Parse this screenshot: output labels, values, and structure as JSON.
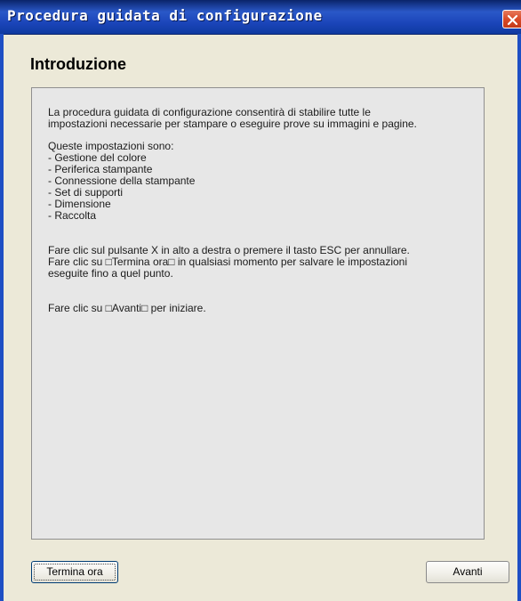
{
  "window": {
    "title": "Procedura guidata di configurazione"
  },
  "page": {
    "title": "Introduzione"
  },
  "content": {
    "intro_line1": "La procedura guidata di configurazione consentirà di stabilire tutte le",
    "intro_line2": "impostazioni necessarie per stampare o eseguire prove su immagini e pagine.",
    "settings_heading": "Queste impostazioni sono:",
    "settings_items": [
      "- Gestione del colore",
      "- Periferica stampante",
      "- Connessione della stampante",
      "- Set di supporti",
      "- Dimensione",
      "- Raccolta"
    ],
    "cancel_line": "Fare clic sul pulsante X in alto a destra o premere il tasto ESC per annullare.",
    "save_line1": "Fare clic su □Termina ora□ in qualsiasi momento per salvare le impostazioni",
    "save_line2": "eseguite fino a quel punto.",
    "start_line": "Fare clic su □Avanti□ per iniziare."
  },
  "buttons": {
    "finish_label": "Termina ora",
    "next_label": "Avanti"
  },
  "icons": {
    "close": "close-icon"
  },
  "colors": {
    "titlebar": "#1a44b8",
    "close_button": "#d84a28",
    "panel_background": "#e7e7e7",
    "dialog_background": "#ece9d8"
  }
}
